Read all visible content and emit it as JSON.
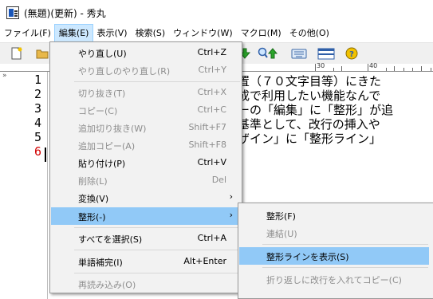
{
  "window": {
    "title": "(無題)(更新) - 秀丸",
    "icon": "hidemaru-app-icon"
  },
  "menubar": {
    "items": [
      {
        "label": "ファイル(F)"
      },
      {
        "label": "編集(E)",
        "active": true
      },
      {
        "label": "表示(V)"
      },
      {
        "label": "検索(S)"
      },
      {
        "label": "ウィンドウ(W)"
      },
      {
        "label": "マクロ(M)"
      },
      {
        "label": "その他(O)"
      }
    ]
  },
  "toolbar": {
    "buttons": [
      "new-file-icon",
      "open-folder-icon",
      "down-arrow-icon",
      "search-next-icon",
      "keyboard-icon",
      "window-split-icon",
      "help-globe-icon"
    ]
  },
  "ruler": {
    "labels": [
      "30",
      "40"
    ],
    "marker": "»"
  },
  "editor": {
    "line_numbers": [
      "1",
      "2",
      "3",
      "4",
      "5",
      "6"
    ],
    "current_line": "6",
    "lines": [
      "置（７０文字目等）にきた",
      "成で利用したい機能なんで",
      "ーの「編集」に「整形」が追",
      "基準として、改行の挿入や",
      "ザイン」に「整形ライン」"
    ]
  },
  "edit_menu": {
    "items": [
      {
        "label": "やり直し(U)",
        "shortcut": "Ctrl+Z",
        "disabled": false
      },
      {
        "label": "やり直しのやり直し(R)",
        "shortcut": "Ctrl+Y",
        "disabled": true
      },
      {
        "label": "切り抜き(T)",
        "shortcut": "Ctrl+X",
        "disabled": true
      },
      {
        "label": "コピー(C)",
        "shortcut": "Ctrl+C",
        "disabled": true
      },
      {
        "label": "追加切り抜き(W)",
        "shortcut": "Shift+F7",
        "disabled": true
      },
      {
        "label": "追加コピー(A)",
        "shortcut": "Shift+F8",
        "disabled": true
      },
      {
        "label": "貼り付け(P)",
        "shortcut": "Ctrl+V",
        "disabled": false
      },
      {
        "label": "削除(L)",
        "shortcut": "Del",
        "disabled": true
      },
      {
        "label": "変換(V)",
        "shortcut": "",
        "disabled": false,
        "submenu": true
      },
      {
        "label": "整形(-)",
        "shortcut": "",
        "disabled": false,
        "submenu": true,
        "highlight": true
      },
      {
        "label": "すべてを選択(S)",
        "shortcut": "Ctrl+A",
        "disabled": false
      },
      {
        "label": "単語補完(I)",
        "shortcut": "Alt+Enter",
        "disabled": false
      },
      {
        "label": "再読み込み(O)",
        "shortcut": "",
        "disabled": true
      }
    ],
    "submenu_arrow": "›"
  },
  "format_submenu": {
    "items": [
      {
        "label": "整形(F)",
        "disabled": false
      },
      {
        "label": "連結(U)",
        "disabled": true
      },
      {
        "label": "整形ラインを表示(S)",
        "disabled": false,
        "highlight": true
      },
      {
        "label": "折り返しに改行を入れてコピー(C)",
        "disabled": true
      }
    ]
  },
  "colors": {
    "highlight": "#91c9f7",
    "menu_active": "#cce8ff",
    "current_line_number": "#d20000",
    "disabled_text": "#8d8d8d"
  }
}
